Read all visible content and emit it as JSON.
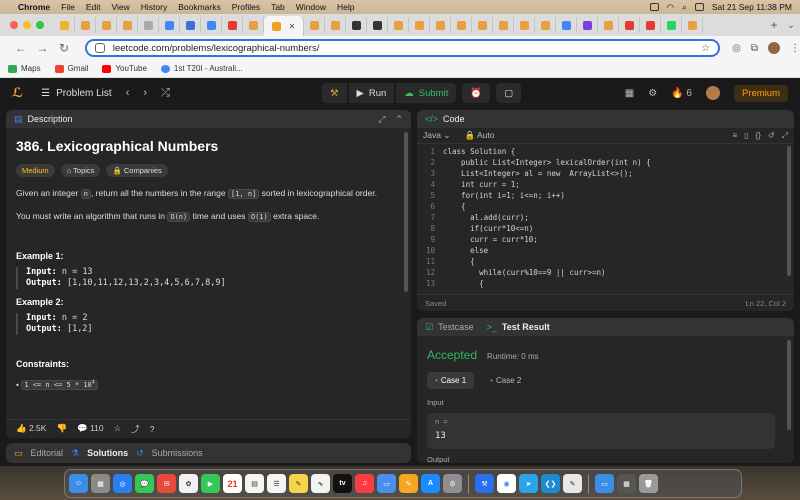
{
  "menubar": {
    "items": [
      "Chrome",
      "File",
      "Edit",
      "View",
      "History",
      "Bookmarks",
      "Profiles",
      "Tab",
      "Window",
      "Help"
    ],
    "datetime": "Sat 21 Sep  11:38 PM"
  },
  "browser": {
    "url": "leetcode.com/problems/lexicographical-numbers/",
    "bookmarks": [
      "Maps",
      "Gmail",
      "YouTube",
      "1st T20I - Australi..."
    ]
  },
  "colors": {
    "accent": "#ffa116",
    "accepted": "#2cbb5d",
    "medium": "#ffc01e",
    "panel": "#262626"
  },
  "nav": {
    "problem_list": "Problem List",
    "run": "Run",
    "submit": "Submit",
    "streak": "6",
    "premium": "Premium"
  },
  "description": {
    "tab_label": "Description",
    "title": "386. Lexicographical Numbers",
    "difficulty": "Medium",
    "topics": "Topics",
    "companies": "Companies",
    "para1": {
      "a": "Given an integer ",
      "n": "n",
      "b": ", return all the numbers in the range ",
      "range": "[1, n]",
      "c": " sorted in lexicographical order."
    },
    "para2": {
      "a": "You must write an algorithm that runs in ",
      "time": "O(n)",
      "b": " time and uses ",
      "space": "O(1)",
      "c": " extra space."
    },
    "examples": [
      {
        "title": "Example 1:",
        "input_label": "Input:",
        "input": "n = 13",
        "output_label": "Output:",
        "output": "[1,10,11,12,13,2,3,4,5,6,7,8,9]"
      },
      {
        "title": "Example 2:",
        "input_label": "Input:",
        "input": "n = 2",
        "output_label": "Output:",
        "output": "[1,2]"
      }
    ],
    "constraints_title": "Constraints:",
    "constraint": "1 <= n <= 5 * 10",
    "constraint_exp": "4",
    "likes": "2.5K",
    "comments": "110"
  },
  "bottom_tabs": [
    "Editorial",
    "Solutions",
    "Submissions"
  ],
  "code": {
    "tab_label": "Code",
    "language": "Java",
    "mode": "Auto",
    "status": "Saved",
    "position": "Ln 22, Col 2",
    "lines": [
      {
        "n": "1",
        "t": "class Solution {"
      },
      {
        "n": "2",
        "t": "    public List<Integer> lexicalOrder(int n) {"
      },
      {
        "n": "3",
        "t": "    List<Integer> al = new  ArrayList<>();"
      },
      {
        "n": "4",
        "t": "    int curr = 1;"
      },
      {
        "n": "5",
        "t": "    for(int i=1; i<=n; i++)"
      },
      {
        "n": "6",
        "t": "    {"
      },
      {
        "n": "7",
        "t": "      al.add(curr);"
      },
      {
        "n": "8",
        "t": "      if(curr*10<=n)"
      },
      {
        "n": "9",
        "t": "      curr = curr*10;"
      },
      {
        "n": "10",
        "t": "      else"
      },
      {
        "n": "11",
        "t": "      {"
      },
      {
        "n": "12",
        "t": "        while(curr%10==9 || curr>=n)"
      },
      {
        "n": "13",
        "t": "        {"
      }
    ]
  },
  "tests": {
    "testcase_tab": "Testcase",
    "result_tab": "Test Result",
    "verdict": "Accepted",
    "runtime": "Runtime: 0 ms",
    "cases": [
      "Case 1",
      "Case 2"
    ],
    "input_label": "Input",
    "input_key": "n =",
    "input_value": "13",
    "output_label": "Output"
  },
  "dock": {
    "calendar_day": "21"
  }
}
